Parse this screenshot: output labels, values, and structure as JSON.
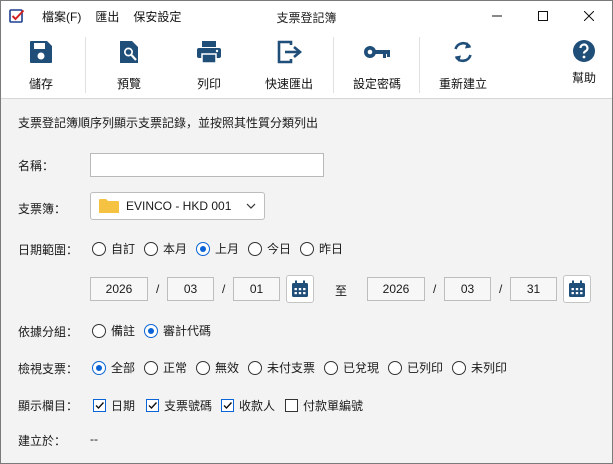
{
  "window": {
    "title": "支票登記簿",
    "menu": [
      "檔案(F)",
      "匯出",
      "保安設定"
    ]
  },
  "toolbar": {
    "save": "儲存",
    "preview": "預覽",
    "print": "列印",
    "quick_export": "快速匯出",
    "set_password": "設定密碼",
    "rebuild": "重新建立",
    "help": "幫助"
  },
  "form": {
    "description": "支票登記簿順序列顯示支票記錄，並按照其性質分類列出",
    "name_label": "名稱：",
    "name_value": "",
    "chequebook_label": "支票簿：",
    "chequebook_value": "EVINCO - HKD 001",
    "date_range_label": "日期範圍：",
    "date_options": [
      "自訂",
      "本月",
      "上月",
      "今日",
      "昨日"
    ],
    "date_selected": "上月",
    "from_year": "2026",
    "from_month": "03",
    "from_day": "01",
    "to_label": "至",
    "to_year": "2026",
    "to_month": "03",
    "to_day": "31",
    "date_sep": "/",
    "group_label": "依據分組：",
    "group_options": [
      "備註",
      "審計代碼"
    ],
    "group_selected": "審計代碼",
    "view_label": "檢視支票：",
    "view_options": [
      "全部",
      "正常",
      "無效",
      "未付支票",
      "已兌現",
      "已列印",
      "未列印"
    ],
    "view_selected": "全部",
    "columns_label": "顯示欄目：",
    "columns": [
      {
        "label": "日期",
        "checked": true
      },
      {
        "label": "支票號碼",
        "checked": true
      },
      {
        "label": "收款人",
        "checked": true
      },
      {
        "label": "付款單編號",
        "checked": false
      }
    ],
    "created_label": "建立於：",
    "created_value": "--"
  },
  "colors": {
    "accent": "#0a64d6",
    "icon": "#1f4e79",
    "folder": "#f5c242"
  }
}
